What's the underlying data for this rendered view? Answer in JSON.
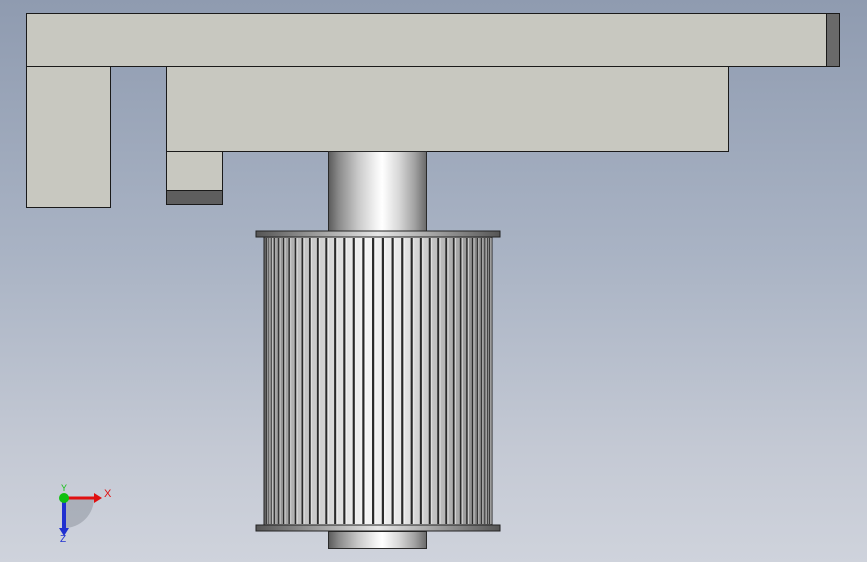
{
  "viewport": {
    "background_top": "#8f9bb0",
    "background_bottom": "#cfd3dc",
    "part_color": "#c8c8c0",
    "edge_color": "#1a1a1a"
  },
  "parts": {
    "top_plate": "top-plate",
    "motor_plate": "motor-plate",
    "left_block": "left-block",
    "small_block": "small-block",
    "shaft": "motor-shaft",
    "pulley": "timing-pulley"
  },
  "triad": {
    "x_label": "X",
    "y_label": "Y",
    "z_label": "Z",
    "x_color": "#e01010",
    "y_color": "#10c010",
    "z_color": "#2030d0"
  }
}
